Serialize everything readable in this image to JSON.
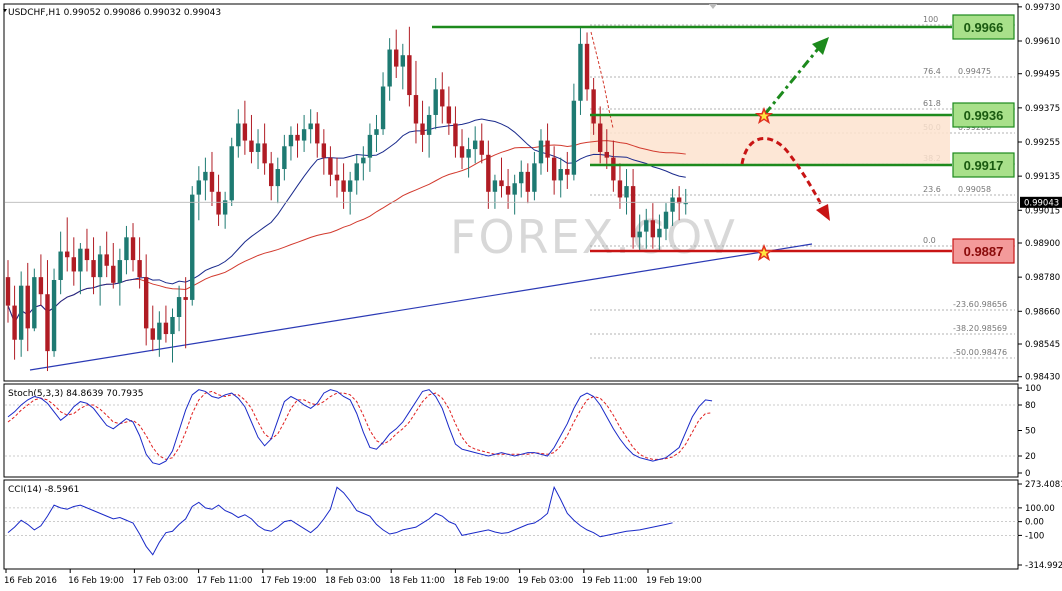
{
  "window": {
    "header": "USDCHF,H1  0.99052 0.99086 0.99032 0.99043",
    "watermark": "FOREX.COV"
  },
  "colors": {
    "bull": "#1e7a72",
    "bear": "#b01c24",
    "ma_fast": "#1a2a8c",
    "ma_slow": "#d23a2e",
    "trendline": "#2b3ab5",
    "resistance": "#1d8a1d",
    "support": "#c81414",
    "level_box_green": "#a8e08a",
    "level_box_red": "#f39a9a",
    "zone": "#fde3cf",
    "stoch_main": "#1a2ac8",
    "stoch_signal": "#e02020",
    "cci": "#1a2ac8"
  },
  "chart_data": [
    {
      "type": "candlestick",
      "name": "USDCHF,H1",
      "price_axis": [
        "0.99730",
        "0.99610",
        "0.99495",
        "0.99375",
        "0.99255",
        "0.99135",
        "0.99015",
        "0.98900",
        "0.98780",
        "0.98660",
        "0.98545",
        "0.98430"
      ],
      "ylim": [
        0.98415,
        0.9974
      ],
      "current_price": "0.99043",
      "x_labels": [
        "16 Feb 2016",
        "16 Feb 19:00",
        "17 Feb 03:00",
        "17 Feb 11:00",
        "17 Feb 19:00",
        "18 Feb 03:00",
        "18 Feb 11:00",
        "18 Feb 19:00",
        "19 Feb 03:00",
        "19 Feb 11:00",
        "19 Feb 19:00"
      ],
      "ohlc": [
        [
          0.9878,
          0.9884,
          0.9862,
          0.9868
        ],
        [
          0.9868,
          0.9875,
          0.9849,
          0.9856
        ],
        [
          0.9856,
          0.988,
          0.985,
          0.9875
        ],
        [
          0.9875,
          0.9883,
          0.9852,
          0.986
        ],
        [
          0.986,
          0.9881,
          0.9859,
          0.9878
        ],
        [
          0.9878,
          0.9886,
          0.9868,
          0.9872
        ],
        [
          0.9872,
          0.9884,
          0.9845,
          0.9852
        ],
        [
          0.9852,
          0.9881,
          0.985,
          0.9877
        ],
        [
          0.9877,
          0.9894,
          0.9872,
          0.9887
        ],
        [
          0.9887,
          0.9899,
          0.988,
          0.9885
        ],
        [
          0.9885,
          0.9892,
          0.9875,
          0.988
        ],
        [
          0.988,
          0.989,
          0.9872,
          0.9888
        ],
        [
          0.9888,
          0.9895,
          0.988,
          0.9884
        ],
        [
          0.9884,
          0.9892,
          0.9872,
          0.9878
        ],
        [
          0.9878,
          0.9889,
          0.9868,
          0.9886
        ],
        [
          0.9886,
          0.9894,
          0.9878,
          0.9882
        ],
        [
          0.9882,
          0.989,
          0.9874,
          0.9876
        ],
        [
          0.9876,
          0.9888,
          0.9868,
          0.9884
        ],
        [
          0.9884,
          0.9896,
          0.9879,
          0.9892
        ],
        [
          0.9892,
          0.9897,
          0.988,
          0.9884
        ],
        [
          0.9884,
          0.9892,
          0.9874,
          0.9878
        ],
        [
          0.9878,
          0.9886,
          0.9854,
          0.986
        ],
        [
          0.986,
          0.9868,
          0.9852,
          0.9856
        ],
        [
          0.9856,
          0.9866,
          0.985,
          0.9862
        ],
        [
          0.9862,
          0.9868,
          0.9855,
          0.9858
        ],
        [
          0.9858,
          0.9867,
          0.9848,
          0.9864
        ],
        [
          0.9864,
          0.9875,
          0.9859,
          0.9871
        ],
        [
          0.9871,
          0.9878,
          0.9853,
          0.987
        ],
        [
          0.987,
          0.991,
          0.9868,
          0.9907
        ],
        [
          0.9907,
          0.9917,
          0.9898,
          0.9912
        ],
        [
          0.9912,
          0.992,
          0.9905,
          0.9915
        ],
        [
          0.9915,
          0.9922,
          0.9903,
          0.9908
        ],
        [
          0.9908,
          0.9914,
          0.9896,
          0.99
        ],
        [
          0.99,
          0.9908,
          0.9895,
          0.9905
        ],
        [
          0.9905,
          0.9927,
          0.9903,
          0.9924
        ],
        [
          0.9924,
          0.9937,
          0.992,
          0.9932
        ],
        [
          0.9932,
          0.994,
          0.9921,
          0.9926
        ],
        [
          0.9926,
          0.9935,
          0.9918,
          0.9922
        ],
        [
          0.9922,
          0.993,
          0.9916,
          0.9925
        ],
        [
          0.9925,
          0.9932,
          0.9914,
          0.9918
        ],
        [
          0.9918,
          0.9922,
          0.9905,
          0.991
        ],
        [
          0.991,
          0.992,
          0.9904,
          0.9916
        ],
        [
          0.9916,
          0.9928,
          0.9912,
          0.9924
        ],
        [
          0.9924,
          0.9931,
          0.9919,
          0.9928
        ],
        [
          0.9928,
          0.9932,
          0.992,
          0.9926
        ],
        [
          0.9926,
          0.9935,
          0.9922,
          0.993
        ],
        [
          0.993,
          0.9937,
          0.9925,
          0.9932
        ],
        [
          0.9932,
          0.9936,
          0.992,
          0.9925
        ],
        [
          0.9925,
          0.993,
          0.9914,
          0.992
        ],
        [
          0.992,
          0.9924,
          0.991,
          0.9914
        ],
        [
          0.9914,
          0.992,
          0.9906,
          0.9912
        ],
        [
          0.9912,
          0.9918,
          0.9902,
          0.9908
        ],
        [
          0.9908,
          0.9915,
          0.99,
          0.9912
        ],
        [
          0.9912,
          0.9921,
          0.9907,
          0.9918
        ],
        [
          0.9918,
          0.9924,
          0.9912,
          0.992
        ],
        [
          0.992,
          0.9932,
          0.9915,
          0.9928
        ],
        [
          0.9928,
          0.9935,
          0.9922,
          0.993
        ],
        [
          0.993,
          0.995,
          0.9928,
          0.9945
        ],
        [
          0.9945,
          0.9962,
          0.994,
          0.9958
        ],
        [
          0.9958,
          0.9965,
          0.9948,
          0.9952
        ],
        [
          0.9952,
          0.996,
          0.9944,
          0.9956
        ],
        [
          0.9956,
          0.9966,
          0.9938,
          0.9942
        ],
        [
          0.9942,
          0.9954,
          0.9925,
          0.9932
        ],
        [
          0.9932,
          0.994,
          0.9922,
          0.9928
        ],
        [
          0.9928,
          0.9938,
          0.992,
          0.9935
        ],
        [
          0.9935,
          0.9948,
          0.993,
          0.9944
        ],
        [
          0.9944,
          0.995,
          0.9932,
          0.9938
        ],
        [
          0.9938,
          0.9945,
          0.9928,
          0.9932
        ],
        [
          0.9932,
          0.9938,
          0.992,
          0.9924
        ],
        [
          0.9924,
          0.993,
          0.9916,
          0.992
        ],
        [
          0.992,
          0.9927,
          0.9913,
          0.9923
        ],
        [
          0.9923,
          0.9931,
          0.9918,
          0.9926
        ],
        [
          0.9926,
          0.9932,
          0.9918,
          0.9921
        ],
        [
          0.9921,
          0.9926,
          0.9902,
          0.9908
        ],
        [
          0.9908,
          0.9914,
          0.9902,
          0.9912
        ],
        [
          0.9912,
          0.992,
          0.9906,
          0.991
        ],
        [
          0.991,
          0.9916,
          0.9902,
          0.9907
        ],
        [
          0.9907,
          0.9914,
          0.99,
          0.9911
        ],
        [
          0.9911,
          0.9919,
          0.9906,
          0.9915
        ],
        [
          0.9915,
          0.9918,
          0.9904,
          0.9908
        ],
        [
          0.9908,
          0.9922,
          0.9905,
          0.9918
        ],
        [
          0.9918,
          0.993,
          0.9914,
          0.9926
        ],
        [
          0.9926,
          0.9932,
          0.9915,
          0.992
        ],
        [
          0.992,
          0.9924,
          0.9907,
          0.9912
        ],
        [
          0.9912,
          0.992,
          0.9906,
          0.9916
        ],
        [
          0.9916,
          0.9922,
          0.9909,
          0.9914
        ],
        [
          0.9914,
          0.9946,
          0.9912,
          0.994
        ],
        [
          0.994,
          0.9966,
          0.9935,
          0.996
        ],
        [
          0.996,
          0.9964,
          0.994,
          0.9944
        ],
        [
          0.9944,
          0.9948,
          0.9928,
          0.9932
        ],
        [
          0.9932,
          0.9938,
          0.9918,
          0.9922
        ],
        [
          0.9922,
          0.993,
          0.9916,
          0.992
        ],
        [
          0.992,
          0.9926,
          0.9908,
          0.9912
        ],
        [
          0.9912,
          0.9918,
          0.9902,
          0.9906
        ],
        [
          0.9906,
          0.9916,
          0.99,
          0.991
        ],
        [
          0.991,
          0.9916,
          0.9888,
          0.9892
        ],
        [
          0.9892,
          0.99,
          0.9887,
          0.9894
        ],
        [
          0.9894,
          0.9902,
          0.9888,
          0.9898
        ],
        [
          0.9898,
          0.9904,
          0.9888,
          0.9892
        ],
        [
          0.9892,
          0.99,
          0.9887,
          0.9895
        ],
        [
          0.9895,
          0.9904,
          0.9891,
          0.9901
        ],
        [
          0.9901,
          0.9909,
          0.9896,
          0.9906
        ],
        [
          0.9906,
          0.991,
          0.9898,
          0.9904
        ],
        [
          0.9904,
          0.9909,
          0.99,
          0.9904
        ]
      ],
      "fib_levels": [
        {
          "ratio": "100",
          "price": ""
        },
        {
          "ratio": "76.4",
          "price": "0.99475"
        },
        {
          "ratio": "61.8",
          "price": ""
        },
        {
          "ratio": "50.0",
          "price": "0.99266"
        },
        {
          "ratio": "38.2",
          "price": ""
        },
        {
          "ratio": "23.6",
          "price": "0.99058"
        },
        {
          "ratio": "0.0",
          "price": ""
        },
        {
          "ratio": "-23.6",
          "price": "0.98656"
        },
        {
          "ratio": "-38.2",
          "price": "0.98569"
        },
        {
          "ratio": "-50.0",
          "price": "0.98476"
        }
      ],
      "key_levels": [
        {
          "label": "0.9966",
          "kind": "resistance"
        },
        {
          "label": "0.9936",
          "kind": "resistance"
        },
        {
          "label": "0.9917",
          "kind": "resistance"
        },
        {
          "label": "0.9887",
          "kind": "support"
        }
      ]
    },
    {
      "type": "line",
      "name": "Stoch(5,3,3)",
      "header": "Stoch(5,3,3) 84.8639 70.7935",
      "y_ticks": [
        "100",
        "80",
        "50",
        "20",
        "0"
      ],
      "ylim": [
        0,
        100
      ],
      "series": [
        {
          "values": [
            66,
            72,
            80,
            86,
            90,
            88,
            82,
            72,
            62,
            68,
            78,
            84,
            82,
            76,
            66,
            56,
            52,
            58,
            64,
            60,
            44,
            22,
            12,
            10,
            14,
            26,
            50,
            74,
            92,
            98,
            96,
            90,
            88,
            92,
            94,
            88,
            78,
            60,
            42,
            32,
            40,
            62,
            84,
            90,
            86,
            80,
            76,
            82,
            94,
            98,
            96,
            90,
            86,
            70,
            48,
            30,
            28,
            36,
            46,
            52,
            60,
            72,
            84,
            96,
            98,
            90,
            76,
            54,
            34,
            28,
            26,
            24,
            22,
            20,
            22,
            24,
            22,
            20,
            22,
            24,
            24,
            22,
            20,
            30,
            44,
            58,
            76,
            90,
            94,
            90,
            80,
            66,
            52,
            40,
            30,
            22,
            18,
            16,
            14,
            16,
            18,
            24,
            30,
            48,
            66,
            78,
            86,
            84.8639
          ]
        },
        {
          "values": [
            60,
            66,
            74,
            80,
            86,
            88,
            86,
            80,
            72,
            68,
            70,
            76,
            80,
            80,
            75,
            68,
            60,
            58,
            60,
            62,
            56,
            44,
            30,
            20,
            16,
            18,
            30,
            48,
            70,
            86,
            94,
            96,
            92,
            90,
            92,
            92,
            86,
            76,
            60,
            46,
            40,
            46,
            60,
            76,
            86,
            86,
            82,
            80,
            84,
            90,
            94,
            94,
            92,
            84,
            68,
            50,
            38,
            34,
            38,
            46,
            52,
            60,
            72,
            84,
            92,
            94,
            88,
            76,
            58,
            42,
            32,
            28,
            26,
            24,
            22,
            22,
            22,
            22,
            22,
            22,
            24,
            23,
            22,
            24,
            32,
            44,
            60,
            74,
            86,
            90,
            88,
            80,
            68,
            54,
            42,
            30,
            22,
            18,
            16,
            16,
            17,
            19,
            24,
            34,
            48,
            62,
            70,
            70.7935
          ]
        }
      ]
    },
    {
      "type": "line",
      "name": "CCI(14)",
      "header": "CCI(14) -8.5961",
      "y_ticks": [
        "273.4081",
        "100.00",
        "0.00",
        "-100",
        "-314.9929"
      ],
      "ylim": [
        -314.9929,
        273.4081
      ],
      "series": [
        {
          "values": [
            -80,
            -40,
            10,
            -20,
            -60,
            -30,
            40,
            120,
            100,
            90,
            110,
            120,
            100,
            80,
            60,
            40,
            20,
            30,
            10,
            -10,
            -90,
            -180,
            -240,
            -150,
            -80,
            -70,
            -20,
            20,
            110,
            140,
            100,
            90,
            120,
            80,
            60,
            30,
            50,
            20,
            -30,
            -60,
            -70,
            -40,
            0,
            10,
            -20,
            -50,
            -80,
            -40,
            20,
            90,
            250,
            210,
            150,
            80,
            60,
            40,
            -20,
            -60,
            -90,
            -80,
            -60,
            -50,
            -40,
            -10,
            20,
            60,
            40,
            0,
            -20,
            -100,
            -90,
            -80,
            -70,
            -60,
            -75,
            -85,
            -80,
            -60,
            -40,
            -20,
            -10,
            20,
            60,
            250,
            160,
            60,
            10,
            -30,
            -60,
            -80,
            -110,
            -100,
            -90,
            -80,
            -70,
            -65,
            -60,
            -50,
            -40,
            -30,
            -20,
            -8.5961
          ]
        }
      ]
    }
  ]
}
